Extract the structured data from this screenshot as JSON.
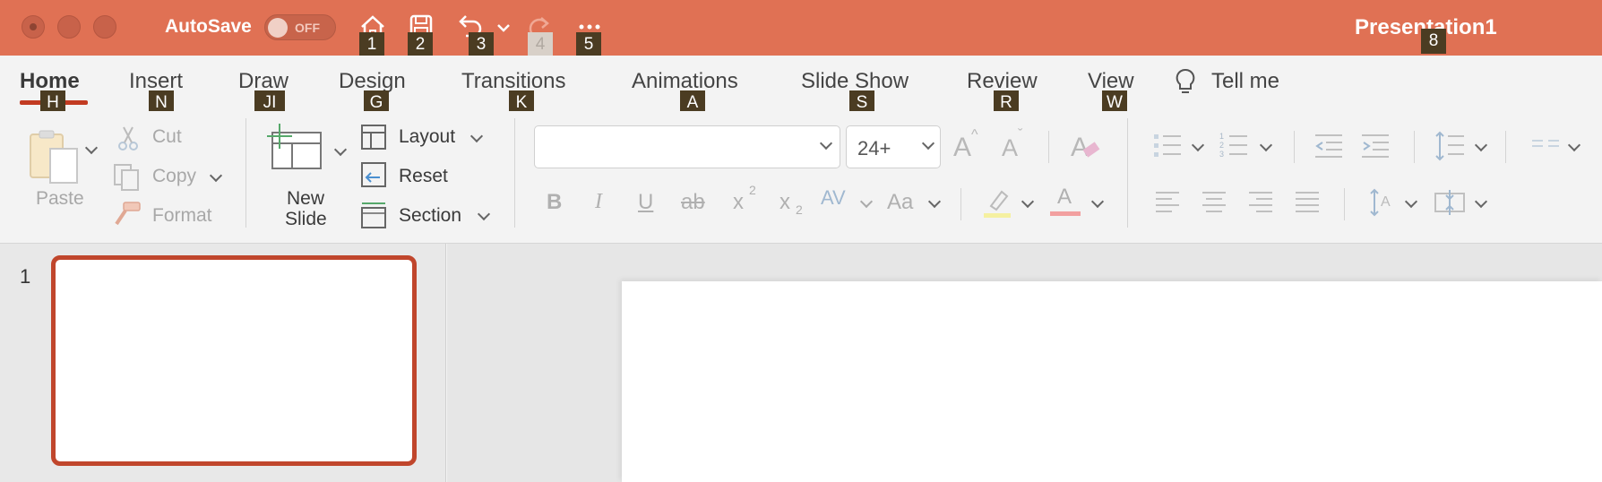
{
  "titlebar": {
    "autosave_label": "AutoSave",
    "autosave_state": "OFF",
    "doc_title": "Presentation1",
    "accent": "#e07154"
  },
  "quick_access": [
    {
      "icon": "home-icon",
      "key": "1"
    },
    {
      "icon": "save-icon",
      "key": "2"
    },
    {
      "icon": "undo-icon",
      "key": "3"
    },
    {
      "icon": "redo-icon",
      "key": "4"
    },
    {
      "icon": "more-icon",
      "key": "5"
    }
  ],
  "title_key": "8",
  "tabs": [
    {
      "label": "Home",
      "key": "H"
    },
    {
      "label": "Insert",
      "key": "N"
    },
    {
      "label": "Draw",
      "key": "JI"
    },
    {
      "label": "Design",
      "key": "G"
    },
    {
      "label": "Transitions",
      "key": "K"
    },
    {
      "label": "Animations",
      "key": "A"
    },
    {
      "label": "Slide Show",
      "key": "S"
    },
    {
      "label": "Review",
      "key": "R"
    },
    {
      "label": "View",
      "key": "W"
    }
  ],
  "tell_me": "Tell me",
  "clipboard": {
    "paste": "Paste",
    "cut": "Cut",
    "copy": "Copy",
    "format": "Format"
  },
  "slides": {
    "new_slide_line1": "New",
    "new_slide_line2": "Slide",
    "layout": "Layout",
    "reset": "Reset",
    "section": "Section"
  },
  "font": {
    "name": "",
    "size": "24+"
  },
  "formatting": {
    "bold": "B",
    "italic": "I",
    "underline": "U",
    "strike": "ab",
    "superscript": "x",
    "subscript": "x",
    "spacing": "AV",
    "change_case": "Aa",
    "grow": "A",
    "shrink": "A",
    "clear": "A",
    "font_color": "A"
  },
  "panel": {
    "slide_number": "1"
  }
}
